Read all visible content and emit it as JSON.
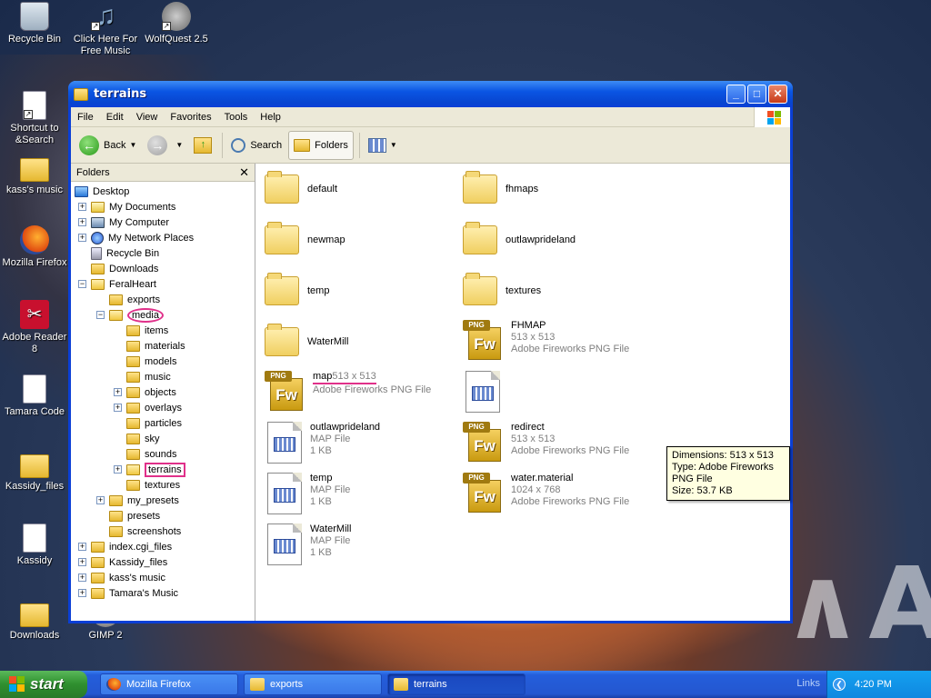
{
  "desktop": {
    "icons": [
      {
        "label": "Recycle Bin",
        "icon": "recycle-bin-icon"
      },
      {
        "label": "Click Here For Free Music",
        "icon": "music-icon"
      },
      {
        "label": "WolfQuest 2.5",
        "icon": "wolf-icon"
      },
      {
        "label": "Shortcut to &Search",
        "icon": "search-shortcut-icon"
      },
      {
        "label": "kass's music",
        "icon": "folder-icon"
      },
      {
        "label": "Mozilla Firefox",
        "icon": "firefox-icon"
      },
      {
        "label": "Adobe Reader 8",
        "icon": "adobe-reader-icon"
      },
      {
        "label": "Tamara Code",
        "icon": "document-icon"
      },
      {
        "label": "Kassidy_files",
        "icon": "folder-icon"
      },
      {
        "label": "Kassidy",
        "icon": "document-icon"
      },
      {
        "label": "Downloads",
        "icon": "folder-icon"
      },
      {
        "label": "GIMP 2",
        "icon": "gimp-icon"
      }
    ],
    "wallpaper_colors": {
      "sky": "#1a2a4a",
      "glow": "#e8a060"
    }
  },
  "window": {
    "title": "terrains",
    "menu": [
      "File",
      "Edit",
      "View",
      "Favorites",
      "Tools",
      "Help"
    ],
    "toolbar": {
      "back": "Back",
      "search": "Search",
      "folders": "Folders"
    },
    "folders_pane": {
      "header": "Folders",
      "tree": [
        {
          "label": "Desktop",
          "level": 0,
          "expander": "none",
          "icon": "desktop-icon"
        },
        {
          "label": "My Documents",
          "level": 1,
          "expander": "+",
          "icon": "my-documents-icon"
        },
        {
          "label": "My Computer",
          "level": 1,
          "expander": "+",
          "icon": "my-computer-icon"
        },
        {
          "label": "My Network Places",
          "level": 1,
          "expander": "+",
          "icon": "network-places-icon"
        },
        {
          "label": "Recycle Bin",
          "level": 1,
          "expander": "none",
          "icon": "recycle-bin-icon"
        },
        {
          "label": "Downloads",
          "level": 1,
          "expander": "none",
          "icon": "folder-icon"
        },
        {
          "label": "FeralHeart",
          "level": 1,
          "expander": "-",
          "icon": "folder-open-icon"
        },
        {
          "label": "exports",
          "level": 2,
          "expander": "none",
          "icon": "folder-icon"
        },
        {
          "label": "media",
          "level": 2,
          "expander": "-",
          "icon": "folder-open-icon",
          "mark": "ellipse"
        },
        {
          "label": "items",
          "level": 3,
          "expander": "none",
          "icon": "folder-icon"
        },
        {
          "label": "materials",
          "level": 3,
          "expander": "none",
          "icon": "folder-icon"
        },
        {
          "label": "models",
          "level": 3,
          "expander": "none",
          "icon": "folder-icon"
        },
        {
          "label": "music",
          "level": 3,
          "expander": "none",
          "icon": "folder-icon"
        },
        {
          "label": "objects",
          "level": 3,
          "expander": "+",
          "icon": "folder-icon"
        },
        {
          "label": "overlays",
          "level": 3,
          "expander": "+",
          "icon": "folder-icon"
        },
        {
          "label": "particles",
          "level": 3,
          "expander": "none",
          "icon": "folder-icon"
        },
        {
          "label": "sky",
          "level": 3,
          "expander": "none",
          "icon": "folder-icon"
        },
        {
          "label": "sounds",
          "level": 3,
          "expander": "none",
          "icon": "folder-icon"
        },
        {
          "label": "terrains",
          "level": 3,
          "expander": "+",
          "icon": "folder-open-icon",
          "mark": "box"
        },
        {
          "label": "textures",
          "level": 3,
          "expander": "none",
          "icon": "folder-icon"
        },
        {
          "label": "my_presets",
          "level": 2,
          "expander": "+",
          "icon": "folder-icon"
        },
        {
          "label": "presets",
          "level": 2,
          "expander": "none",
          "icon": "folder-icon"
        },
        {
          "label": "screenshots",
          "level": 2,
          "expander": "none",
          "icon": "folder-icon"
        },
        {
          "label": "index.cgi_files",
          "level": 1,
          "expander": "+",
          "icon": "folder-icon"
        },
        {
          "label": "Kassidy_files",
          "level": 1,
          "expander": "+",
          "icon": "folder-icon"
        },
        {
          "label": "kass's music",
          "level": 1,
          "expander": "+",
          "icon": "folder-icon"
        },
        {
          "label": "Tamara's Music",
          "level": 1,
          "expander": "+",
          "icon": "folder-icon"
        }
      ]
    },
    "files": [
      {
        "name": "default",
        "kind": "folder"
      },
      {
        "name": "fhmaps",
        "kind": "folder"
      },
      {
        "name": "newmap",
        "kind": "folder"
      },
      {
        "name": "outlawprideland",
        "kind": "folder"
      },
      {
        "name": "temp",
        "kind": "folder"
      },
      {
        "name": "textures",
        "kind": "folder"
      },
      {
        "name": "WaterMill",
        "kind": "folder"
      },
      {
        "name": "FHMAP",
        "kind": "png",
        "dims": "513 x 513",
        "type": "Adobe Fireworks PNG File"
      },
      {
        "name": "map",
        "kind": "png",
        "dims": "513 x 513",
        "type": "Adobe Fireworks PNG File",
        "mark": "underline"
      },
      {
        "name": "",
        "kind": "map-partial"
      },
      {
        "name": "outlawprideland",
        "kind": "map",
        "type": "MAP File",
        "size": "1 KB"
      },
      {
        "name": "redirect",
        "kind": "png",
        "dims": "513 x 513",
        "type": "Adobe Fireworks PNG File"
      },
      {
        "name": "temp",
        "kind": "map",
        "type": "MAP File",
        "size": "1 KB"
      },
      {
        "name": "water.material",
        "kind": "png",
        "dims": "1024 x 768",
        "type": "Adobe Fireworks PNG File"
      },
      {
        "name": "WaterMill",
        "kind": "map",
        "type": "MAP File",
        "size": "1 KB"
      }
    ],
    "tooltip": {
      "dimensions": "Dimensions: 513 x 513",
      "type": "Type: Adobe Fireworks PNG File",
      "size": "Size: 53.7 KB"
    }
  },
  "taskbar": {
    "start": "start",
    "tasks": [
      {
        "label": "Mozilla Firefox",
        "icon": "firefox-icon",
        "active": false
      },
      {
        "label": "exports",
        "icon": "folder-icon",
        "active": false
      },
      {
        "label": "terrains",
        "icon": "folder-icon",
        "active": true
      }
    ],
    "links": "Links",
    "clock": "4:20 PM"
  },
  "colors": {
    "xp_blue": "#0a3fd6",
    "annotation_pink": "#e0308a",
    "tooltip_bg": "#ffffe1"
  }
}
